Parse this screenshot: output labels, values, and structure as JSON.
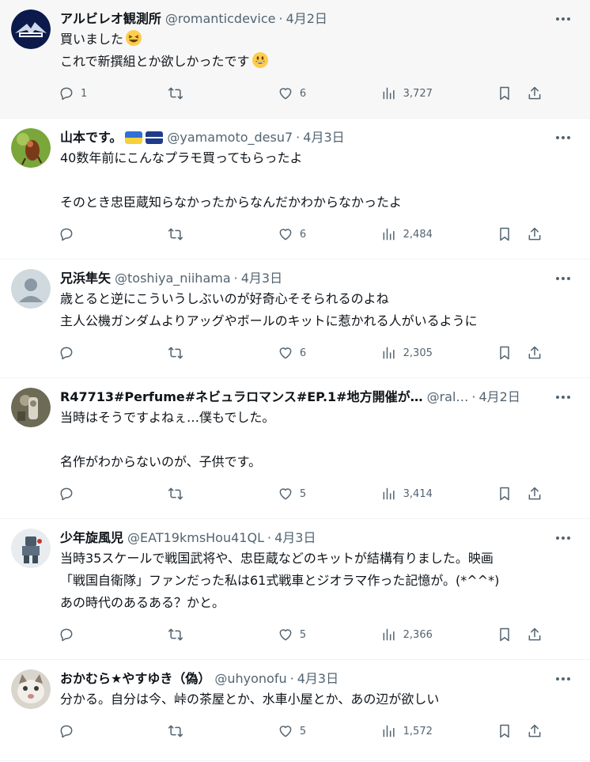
{
  "colors": {
    "name": "#0f1419",
    "secondary": "#536471",
    "highlight_bg": "#f7f7f7",
    "divider": "#eff3f4"
  },
  "icons": {
    "more": "more-horizontal-icon",
    "reply": "reply-icon",
    "retweet": "retweet-icon",
    "like": "like-icon",
    "views": "views-icon",
    "bookmark": "bookmark-icon",
    "share": "share-icon"
  },
  "tweets": [
    {
      "display_name": "アルビレオ観測所",
      "handle": "@romanticdevice",
      "separator": "·",
      "date": "4月2日",
      "lines": [
        "買いました",
        "これで新撰組とか欲しかったです"
      ],
      "reply_count": "1",
      "retweet_count": "",
      "like_count": "6",
      "view_count": "3,727"
    },
    {
      "display_name": "山本です。",
      "handle": "@yamamoto_desu7",
      "separator": "·",
      "date": "4月3日",
      "lines": [
        "40数年前にこんなプラモ買ってもらったよ",
        "",
        "そのとき忠臣蔵知らなかったからなんだかわからなかったよ"
      ],
      "reply_count": "",
      "retweet_count": "",
      "like_count": "6",
      "view_count": "2,484"
    },
    {
      "display_name": "兄浜隼矢",
      "handle": "@toshiya_niihama",
      "separator": "·",
      "date": "4月3日",
      "lines": [
        "歳とると逆にこういうしぶいのが好奇心そそられるのよね",
        "主人公機ガンダムよりアッグやボールのキットに惹かれる人がいるように"
      ],
      "reply_count": "",
      "retweet_count": "",
      "like_count": "6",
      "view_count": "2,305"
    },
    {
      "display_name": "R47713#Perfume#ネビュラロマンス#EP.1#地方開催が…",
      "handle": "@ral…",
      "separator": "·",
      "date": "4月2日",
      "lines": [
        "当時はそうですよねぇ…僕もでした。",
        "",
        "名作がわからないのが、子供です。"
      ],
      "reply_count": "",
      "retweet_count": "",
      "like_count": "5",
      "view_count": "3,414"
    },
    {
      "display_name": "少年旋風児",
      "handle": "@EAT19kmsHou41QL",
      "separator": "·",
      "date": "4月3日",
      "lines": [
        "当時35スケールで戦国武将や、忠臣蔵などのキットが結構有りました。映画",
        "「戦国自衛隊」ファンだった私は61式戦車とジオラマ作った記憶が。(*^^*)",
        "あの時代のあるある？かと。"
      ],
      "reply_count": "",
      "retweet_count": "",
      "like_count": "5",
      "view_count": "2,366"
    },
    {
      "display_name": "おかむら★やすゆき（偽）",
      "handle": "@uhyonofu",
      "separator": "·",
      "date": "4月3日",
      "lines": [
        "分かる。自分は今、峠の茶屋とか、水車小屋とか、あの辺が欲しい"
      ],
      "reply_count": "",
      "retweet_count": "",
      "like_count": "5",
      "view_count": "1,572"
    }
  ]
}
